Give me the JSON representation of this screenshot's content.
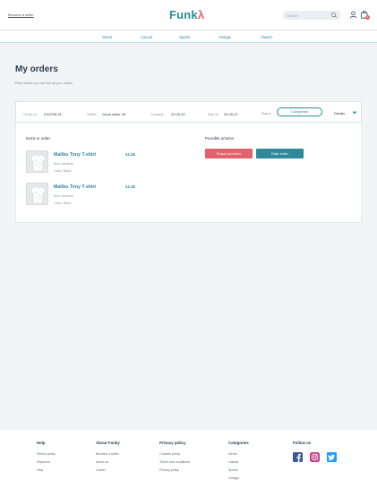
{
  "header": {
    "become_seller": "Become a seller",
    "logo_main": "Funk",
    "logo_accent": "λ",
    "search_placeholder": "Search",
    "cart_count": "0"
  },
  "nav": {
    "items": [
      "Street",
      "Casual",
      "Sports",
      "Vintage",
      "Classic"
    ]
  },
  "page": {
    "title": "My orders",
    "subtitle": "Place where you can find all your orders"
  },
  "order": {
    "order_id_label": "Order id:",
    "order_id": "D31239-31",
    "seller_label": "Seller:",
    "seller": "Good seller 28",
    "created_label": "Created:",
    "created": "23.05.22",
    "due_label": "Due to:",
    "due": "30.05.22",
    "status_label": "Status:",
    "status": "Completed",
    "details_label": "Details",
    "items_label": "Items in order:",
    "actions_label": "Possible actions:",
    "report_button": "Report problem",
    "rate_button": "Rate seller",
    "items": [
      {
        "name": "Malibu Tony T-shirt",
        "price": "41.0$",
        "size": "Size: Medium",
        "color": "Color: Black"
      },
      {
        "name": "Malibu Tony T-shirt",
        "price": "41.0$",
        "size": "Size: Medium",
        "color": "Color: Black"
      }
    ]
  },
  "footer": {
    "help_title": "Help",
    "help_links": [
      "Return policy",
      "Shipment",
      "Help"
    ],
    "about_title": "About Funky",
    "about_links": [
      "Become a seller",
      "About us",
      "Career"
    ],
    "privacy_title": "Privacy policy",
    "privacy_links": [
      "Cookies policy",
      "Terms and conditions",
      "Privacy policy"
    ],
    "categories_title": "Categories",
    "categories_links": [
      "Street",
      "Casual",
      "Sports",
      "Vintage"
    ],
    "follow_title": "Follow us",
    "social": [
      "facebook-icon",
      "instagram-icon",
      "twitter-icon"
    ],
    "colors": {
      "facebook": "#3b5998",
      "instagram": "#c13584",
      "twitter": "#1da1f2"
    }
  },
  "colors": {
    "accent": "#2e8a9a",
    "danger": "#e2626b"
  }
}
